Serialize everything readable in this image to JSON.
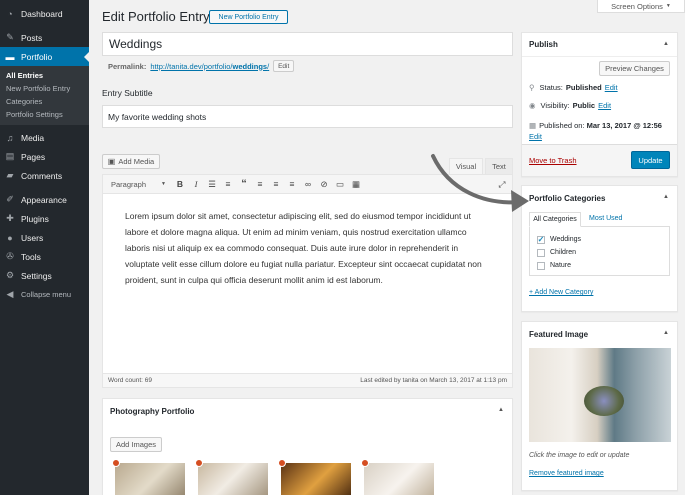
{
  "sidebar": {
    "items": [
      {
        "label": "Dashboard",
        "icon": "dashboard-icon"
      },
      {
        "label": "Posts",
        "icon": "pin-icon"
      },
      {
        "label": "Portfolio",
        "icon": "folder-icon"
      },
      {
        "label": "Media",
        "icon": "media-icon"
      },
      {
        "label": "Pages",
        "icon": "pages-icon"
      },
      {
        "label": "Comments",
        "icon": "comments-icon"
      },
      {
        "label": "Appearance",
        "icon": "brush-icon"
      },
      {
        "label": "Plugins",
        "icon": "plugin-icon"
      },
      {
        "label": "Users",
        "icon": "users-icon"
      },
      {
        "label": "Tools",
        "icon": "wrench-icon"
      },
      {
        "label": "Settings",
        "icon": "settings-icon"
      },
      {
        "label": "Collapse menu",
        "icon": "collapse-icon"
      }
    ],
    "portfolio_sub": [
      "All Entries",
      "New Portfolio Entry",
      "Categories",
      "Portfolio Settings"
    ],
    "accent": "#0073aa"
  },
  "header": {
    "title": "Edit Portfolio Entry",
    "new_button": "New Portfolio Entry",
    "screen_options": "Screen Options"
  },
  "entry": {
    "title_value": "Weddings",
    "permalink_label": "Permalink:",
    "permalink_base": "http://tanita.dev/portfolio/",
    "permalink_slug": "weddings",
    "permalink_end": "/",
    "edit_label": "Edit",
    "subtitle_label": "Entry Subtitle",
    "subtitle_value": "My favorite wedding shots"
  },
  "editor": {
    "add_media": "Add Media",
    "tab_visual": "Visual",
    "tab_text": "Text",
    "format": "Paragraph",
    "body": "Lorem ipsum dolor sit amet, consectetur adipiscing elit, sed do eiusmod tempor incididunt ut labore et dolore magna aliqua. Ut enim ad minim veniam, quis nostrud exercitation ullamco laboris nisi ut aliquip ex ea commodo consequat. Duis aute irure dolor in reprehenderit in voluptate velit esse cillum dolore eu fugiat nulla pariatur. Excepteur sint occaecat cupidatat non proident, sunt in culpa qui officia deserunt mollit anim id est laborum.",
    "word_count": "Word count: 69",
    "last_edited": "Last edited by tanita on March 13, 2017 at 1:13 pm"
  },
  "photo": {
    "title": "Photography Portfolio",
    "add_images": "Add Images"
  },
  "publish": {
    "title": "Publish",
    "preview": "Preview Changes",
    "status_label": "Status:",
    "status_value": "Published",
    "visibility_label": "Visibility:",
    "visibility_value": "Public",
    "published_label": "Published on:",
    "published_value": "Mar 13, 2017 @ 12:56",
    "edit": "Edit",
    "trash": "Move to Trash",
    "update": "Update"
  },
  "categories": {
    "title": "Portfolio Categories",
    "tab_all": "All Categories",
    "tab_used": "Most Used",
    "items": [
      {
        "label": "Weddings",
        "checked": true
      },
      {
        "label": "Children",
        "checked": false
      },
      {
        "label": "Nature",
        "checked": false
      }
    ],
    "add_new": "+ Add New Category"
  },
  "featured": {
    "title": "Featured Image",
    "hint": "Click the image to edit or update",
    "remove": "Remove featured image"
  }
}
